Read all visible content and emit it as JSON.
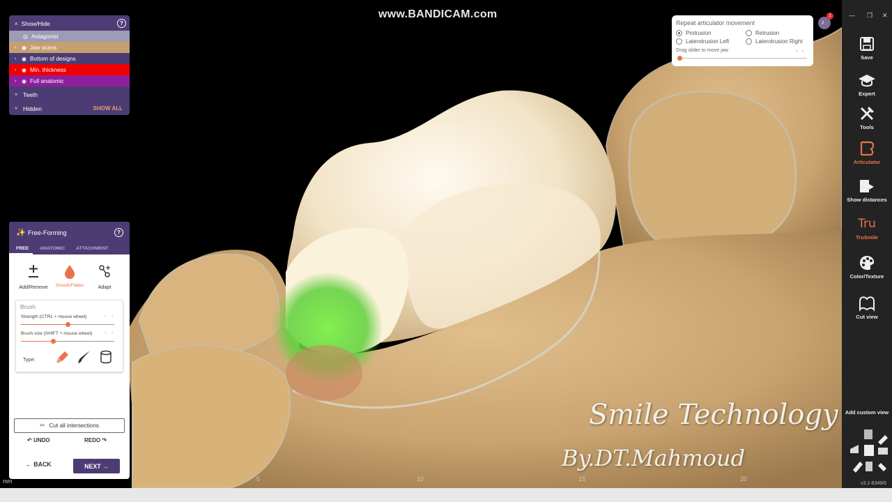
{
  "watermark": {
    "top": "www.BANDICAM.com",
    "brand": "Smile Technology",
    "author": "By.DT.Mahmoud"
  },
  "ruler": {
    "unit": "mm",
    "ticks": [
      "5",
      "10",
      "15",
      "20"
    ]
  },
  "show_hide": {
    "title": "Show/Hide",
    "items": [
      {
        "label": "Antagonist",
        "color": "#9c9cb4"
      },
      {
        "label": "Jaw scans",
        "color": "#c5a06e"
      },
      {
        "label": "Bottom of designs",
        "color": "#4c3c73"
      },
      {
        "label": "Min. thickness",
        "color": "#f00000"
      },
      {
        "label": "Full anatomic",
        "color": "#8e1f9c"
      }
    ],
    "teeth_label": "Teeth",
    "hidden_label": "Hidden",
    "show_all": "SHOW ALL"
  },
  "articulator": {
    "title": "Repeat articulator movement",
    "options": [
      {
        "label": "Protrusion",
        "selected": true
      },
      {
        "label": "Retrusion",
        "selected": false
      },
      {
        "label": "Laterotrusion Left",
        "selected": false
      },
      {
        "label": "Laterotrusion Right",
        "selected": false
      }
    ],
    "drag_label": "Drag slider to move jaw",
    "slider_value": 0
  },
  "notifications": {
    "count": "1"
  },
  "free_forming": {
    "title": "Free-Forming",
    "tabs": [
      "FREE",
      "ANATOMIC",
      "ATTACHMENT"
    ],
    "active_tab": "FREE",
    "tools": [
      {
        "label": "Add/Remove",
        "icon": "plus-minus-icon"
      },
      {
        "label": "Smooth/Flatten",
        "icon": "drop-icon",
        "active": true
      },
      {
        "label": "Adapt",
        "icon": "adapt-icon"
      }
    ],
    "brush": {
      "title": "Brush",
      "strength_label": "Strength (CTRL + mouse wheel)",
      "strength_value": 0.5,
      "size_label": "Brush size (SHIFT + mouse wheel)",
      "size_value": 0.35,
      "type_label": "Type:"
    },
    "cut_all": "Cut all intersections",
    "undo": "UNDO",
    "redo": "REDO",
    "back": "BACK",
    "next": "NEXT"
  },
  "sidebar": {
    "items": [
      {
        "label": "Save",
        "icon": "save-icon"
      },
      {
        "label": "Expert",
        "icon": "graduation-cap-icon"
      },
      {
        "label": "Tools",
        "icon": "tools-icon"
      },
      {
        "label": "Articulator",
        "icon": "articulator-icon",
        "active": true
      },
      {
        "label": "Show distances",
        "icon": "distances-icon"
      },
      {
        "label": "TruSmile",
        "icon": "trusmile-icon",
        "active": true
      },
      {
        "label": "Color/Texture",
        "icon": "palette-icon"
      },
      {
        "label": "Cut view",
        "icon": "cut-view-icon"
      }
    ],
    "trusmile_logo": "Tru",
    "custom_view": "Add custom view",
    "version": "v3.1-8349/6"
  },
  "colors": {
    "panel": "#4c3c73",
    "accent": "#e8734a",
    "sidebar": "#232323",
    "gum": "#c9a370",
    "tooth": "#f1e3c6"
  }
}
